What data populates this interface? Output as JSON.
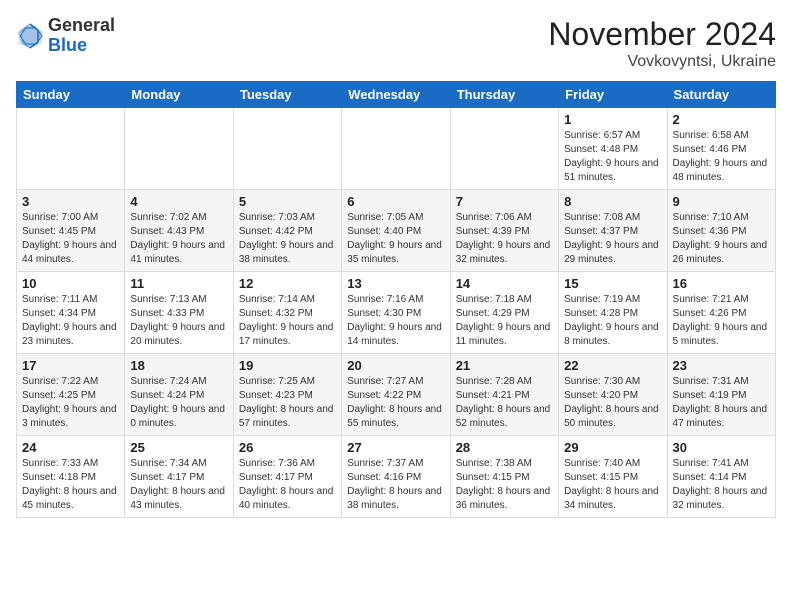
{
  "header": {
    "logo_general": "General",
    "logo_blue": "Blue",
    "month_title": "November 2024",
    "location": "Vovkovyntsi, Ukraine"
  },
  "weekdays": [
    "Sunday",
    "Monday",
    "Tuesday",
    "Wednesday",
    "Thursday",
    "Friday",
    "Saturday"
  ],
  "weeks": [
    [
      {
        "day": "",
        "info": ""
      },
      {
        "day": "",
        "info": ""
      },
      {
        "day": "",
        "info": ""
      },
      {
        "day": "",
        "info": ""
      },
      {
        "day": "",
        "info": ""
      },
      {
        "day": "1",
        "info": "Sunrise: 6:57 AM\nSunset: 4:48 PM\nDaylight: 9 hours and 51 minutes."
      },
      {
        "day": "2",
        "info": "Sunrise: 6:58 AM\nSunset: 4:46 PM\nDaylight: 9 hours and 48 minutes."
      }
    ],
    [
      {
        "day": "3",
        "info": "Sunrise: 7:00 AM\nSunset: 4:45 PM\nDaylight: 9 hours and 44 minutes."
      },
      {
        "day": "4",
        "info": "Sunrise: 7:02 AM\nSunset: 4:43 PM\nDaylight: 9 hours and 41 minutes."
      },
      {
        "day": "5",
        "info": "Sunrise: 7:03 AM\nSunset: 4:42 PM\nDaylight: 9 hours and 38 minutes."
      },
      {
        "day": "6",
        "info": "Sunrise: 7:05 AM\nSunset: 4:40 PM\nDaylight: 9 hours and 35 minutes."
      },
      {
        "day": "7",
        "info": "Sunrise: 7:06 AM\nSunset: 4:39 PM\nDaylight: 9 hours and 32 minutes."
      },
      {
        "day": "8",
        "info": "Sunrise: 7:08 AM\nSunset: 4:37 PM\nDaylight: 9 hours and 29 minutes."
      },
      {
        "day": "9",
        "info": "Sunrise: 7:10 AM\nSunset: 4:36 PM\nDaylight: 9 hours and 26 minutes."
      }
    ],
    [
      {
        "day": "10",
        "info": "Sunrise: 7:11 AM\nSunset: 4:34 PM\nDaylight: 9 hours and 23 minutes."
      },
      {
        "day": "11",
        "info": "Sunrise: 7:13 AM\nSunset: 4:33 PM\nDaylight: 9 hours and 20 minutes."
      },
      {
        "day": "12",
        "info": "Sunrise: 7:14 AM\nSunset: 4:32 PM\nDaylight: 9 hours and 17 minutes."
      },
      {
        "day": "13",
        "info": "Sunrise: 7:16 AM\nSunset: 4:30 PM\nDaylight: 9 hours and 14 minutes."
      },
      {
        "day": "14",
        "info": "Sunrise: 7:18 AM\nSunset: 4:29 PM\nDaylight: 9 hours and 11 minutes."
      },
      {
        "day": "15",
        "info": "Sunrise: 7:19 AM\nSunset: 4:28 PM\nDaylight: 9 hours and 8 minutes."
      },
      {
        "day": "16",
        "info": "Sunrise: 7:21 AM\nSunset: 4:26 PM\nDaylight: 9 hours and 5 minutes."
      }
    ],
    [
      {
        "day": "17",
        "info": "Sunrise: 7:22 AM\nSunset: 4:25 PM\nDaylight: 9 hours and 3 minutes."
      },
      {
        "day": "18",
        "info": "Sunrise: 7:24 AM\nSunset: 4:24 PM\nDaylight: 9 hours and 0 minutes."
      },
      {
        "day": "19",
        "info": "Sunrise: 7:25 AM\nSunset: 4:23 PM\nDaylight: 8 hours and 57 minutes."
      },
      {
        "day": "20",
        "info": "Sunrise: 7:27 AM\nSunset: 4:22 PM\nDaylight: 8 hours and 55 minutes."
      },
      {
        "day": "21",
        "info": "Sunrise: 7:28 AM\nSunset: 4:21 PM\nDaylight: 8 hours and 52 minutes."
      },
      {
        "day": "22",
        "info": "Sunrise: 7:30 AM\nSunset: 4:20 PM\nDaylight: 8 hours and 50 minutes."
      },
      {
        "day": "23",
        "info": "Sunrise: 7:31 AM\nSunset: 4:19 PM\nDaylight: 8 hours and 47 minutes."
      }
    ],
    [
      {
        "day": "24",
        "info": "Sunrise: 7:33 AM\nSunset: 4:18 PM\nDaylight: 8 hours and 45 minutes."
      },
      {
        "day": "25",
        "info": "Sunrise: 7:34 AM\nSunset: 4:17 PM\nDaylight: 8 hours and 43 minutes."
      },
      {
        "day": "26",
        "info": "Sunrise: 7:36 AM\nSunset: 4:17 PM\nDaylight: 8 hours and 40 minutes."
      },
      {
        "day": "27",
        "info": "Sunrise: 7:37 AM\nSunset: 4:16 PM\nDaylight: 8 hours and 38 minutes."
      },
      {
        "day": "28",
        "info": "Sunrise: 7:38 AM\nSunset: 4:15 PM\nDaylight: 8 hours and 36 minutes."
      },
      {
        "day": "29",
        "info": "Sunrise: 7:40 AM\nSunset: 4:15 PM\nDaylight: 8 hours and 34 minutes."
      },
      {
        "day": "30",
        "info": "Sunrise: 7:41 AM\nSunset: 4:14 PM\nDaylight: 8 hours and 32 minutes."
      }
    ]
  ]
}
